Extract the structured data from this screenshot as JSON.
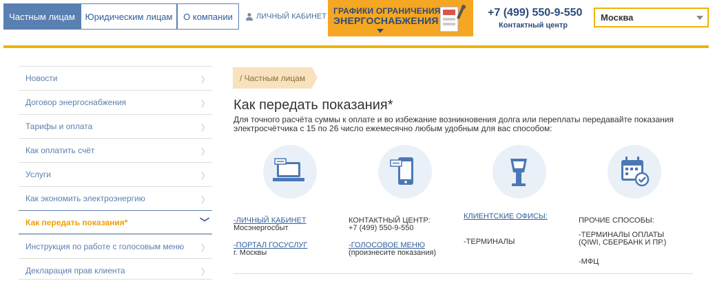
{
  "header": {
    "tabs": [
      {
        "label": "Частным лицам",
        "active": true
      },
      {
        "label": "Юридическим лицам",
        "active": false
      },
      {
        "label": "О компании",
        "active": false
      }
    ],
    "cabinet_label": "ЛИЧНЫЙ КАБИНЕТ",
    "banner": {
      "line1": "Графики ограничения",
      "line2": "энергоснабжения"
    },
    "phone": "+7 (499) 550-9-550",
    "contact_center": "Контактный центр",
    "city": "Москва"
  },
  "sidebar": {
    "items": [
      {
        "label": "Новости"
      },
      {
        "label": "Договор энергоснабжения"
      },
      {
        "label": "Тарифы и оплата"
      },
      {
        "label": "Как оплатить счёт"
      },
      {
        "label": "Услуги"
      },
      {
        "label": "Как экономить электроэнергию"
      },
      {
        "label": "Как передать показания*",
        "active": true
      },
      {
        "label": "Инструкция по работе с голосовым меню"
      },
      {
        "label": "Декларация прав клиента"
      }
    ]
  },
  "breadcrumb": "/ Частным лицам",
  "page_title": "Как передать показания*",
  "intro": "Для точного расчёта суммы к оплате и во избежание возникновения долга или переплаты передавайте показания электросчётчика с 15 по 26 число ежемесячно любым удобным для вас способом:",
  "icons": [
    "laptop-icon",
    "phone-icon",
    "terminal-icon",
    "calendar-icon"
  ],
  "methods": {
    "col1": {
      "link1": "-Личный кабинет",
      "text1": "Мосэнергосбыт",
      "link2": "-Портал госуслуг",
      "text2": "г. Москвы"
    },
    "col2": {
      "title": "Контактный центр:",
      "text1": "+7 (499) 550-9-550",
      "link1": "-Голосовое меню",
      "text2": "(произнесите показания)"
    },
    "col3": {
      "link1": "Клиентские офисы:",
      "text1": "-Терминалы"
    },
    "col4": {
      "title": "Прочие способы:",
      "text1": "-Терминалы оплаты",
      "text2": "(QIWI, СБЕРБАНК  И ПР.)",
      "text3": "-МФЦ"
    }
  },
  "colors": {
    "brand_blue": "#5a7fb1",
    "accent_yellow": "#f0b400",
    "banner_orange": "#f5a623",
    "active_orange": "#f0a000"
  }
}
